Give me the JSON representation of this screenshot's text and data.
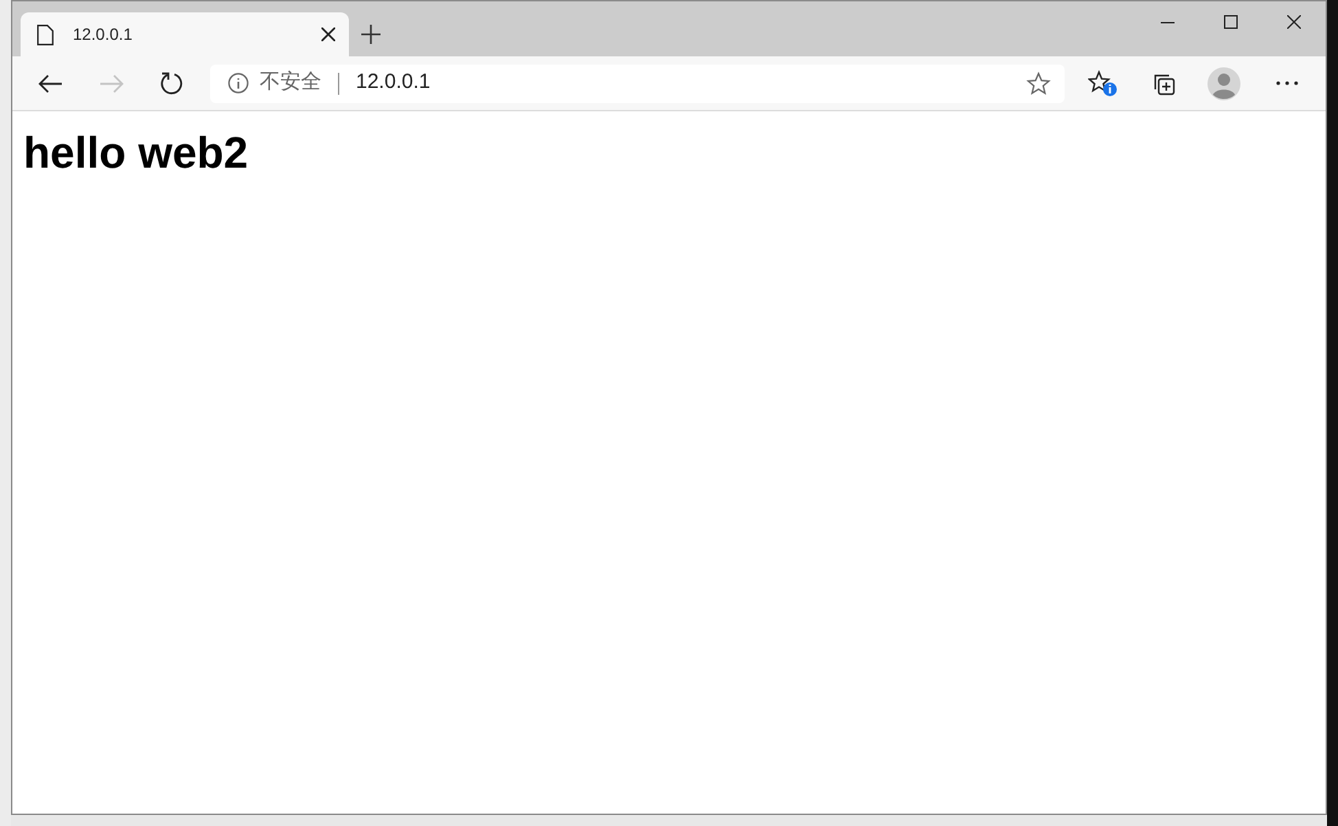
{
  "tabs": [
    {
      "title": "12.0.0.1",
      "selected": true
    }
  ],
  "address_bar": {
    "security_label": "不安全",
    "url": "12.0.0.1"
  },
  "toolbar": {
    "forward_disabled": true
  },
  "page": {
    "heading": "hello web2"
  }
}
